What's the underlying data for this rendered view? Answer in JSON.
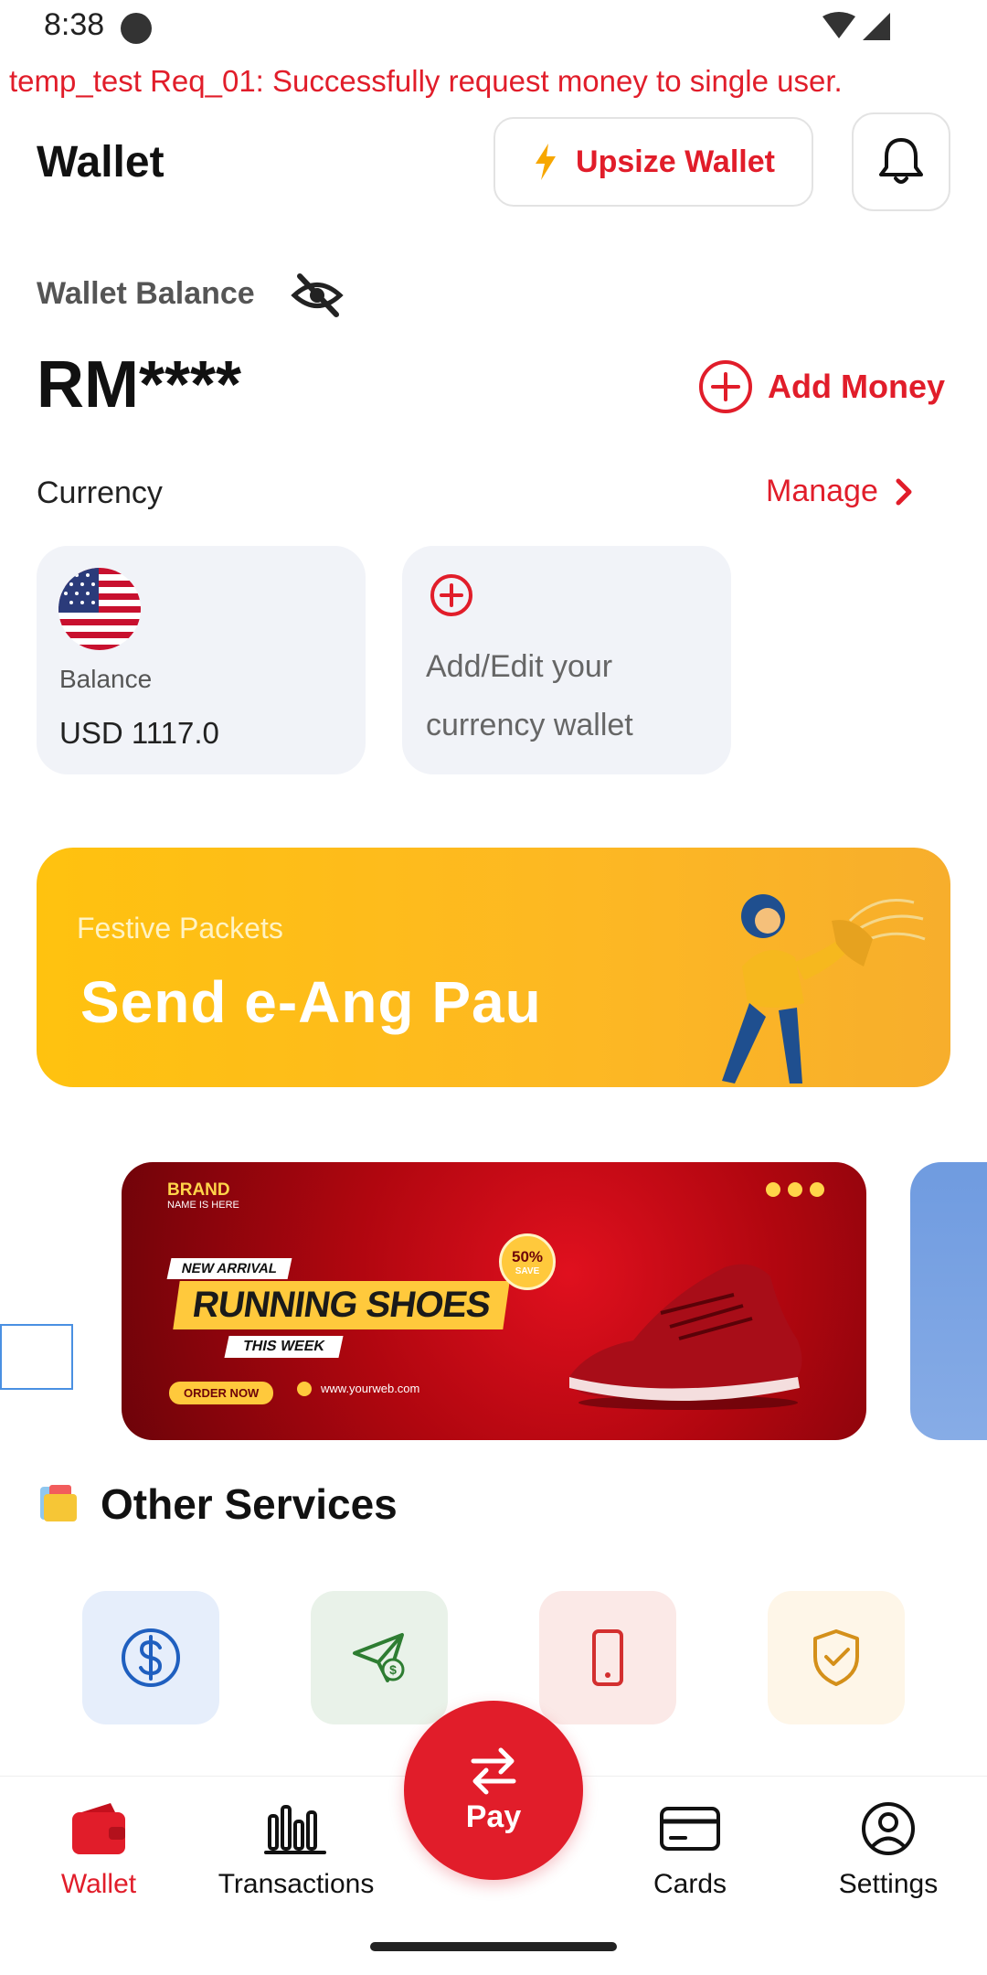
{
  "status_bar": {
    "time": "8:38"
  },
  "debug_banner": "temp_test Req_01: Successfully request money to single user.",
  "header": {
    "title": "Wallet",
    "upsize_label": "Upsize Wallet"
  },
  "balance": {
    "label": "Wallet Balance",
    "amount": "RM****",
    "add_money_label": "Add Money"
  },
  "currency": {
    "title": "Currency",
    "manage_label": "Manage",
    "usd_card": {
      "label": "Balance",
      "value": "USD 1117.0"
    },
    "add_card_text": "Add/Edit your currency wallet"
  },
  "festive_banner": {
    "subtitle": "Festive Packets",
    "title": "Send e-Ang Pau"
  },
  "promo_banner": {
    "brand": "BRAND",
    "brand_sub": "NAME IS HERE",
    "tag": "NEW ARRIVAL",
    "headline": "RUNNING SHOES",
    "subline": "THIS WEEK",
    "badge_pct": "50%",
    "badge_save": "SAVE",
    "cta": "ORDER NOW",
    "url": "www.yourweb.com"
  },
  "other_services": {
    "title": "Other Services",
    "items": [
      {
        "icon": "dollar-icon"
      },
      {
        "icon": "send-money-icon"
      },
      {
        "icon": "mobile-icon"
      },
      {
        "icon": "shield-check-icon"
      }
    ]
  },
  "bottom_nav": {
    "items": [
      {
        "label": "Wallet",
        "icon": "wallet-icon",
        "active": true
      },
      {
        "label": "Transactions",
        "icon": "bar-chart-icon"
      },
      {
        "label": "Cards",
        "icon": "card-icon"
      },
      {
        "label": "Settings",
        "icon": "user-circle-icon"
      }
    ],
    "pay_label": "Pay"
  },
  "colors": {
    "accent": "#e11d2a",
    "banner_yellow": "#fdb823"
  }
}
